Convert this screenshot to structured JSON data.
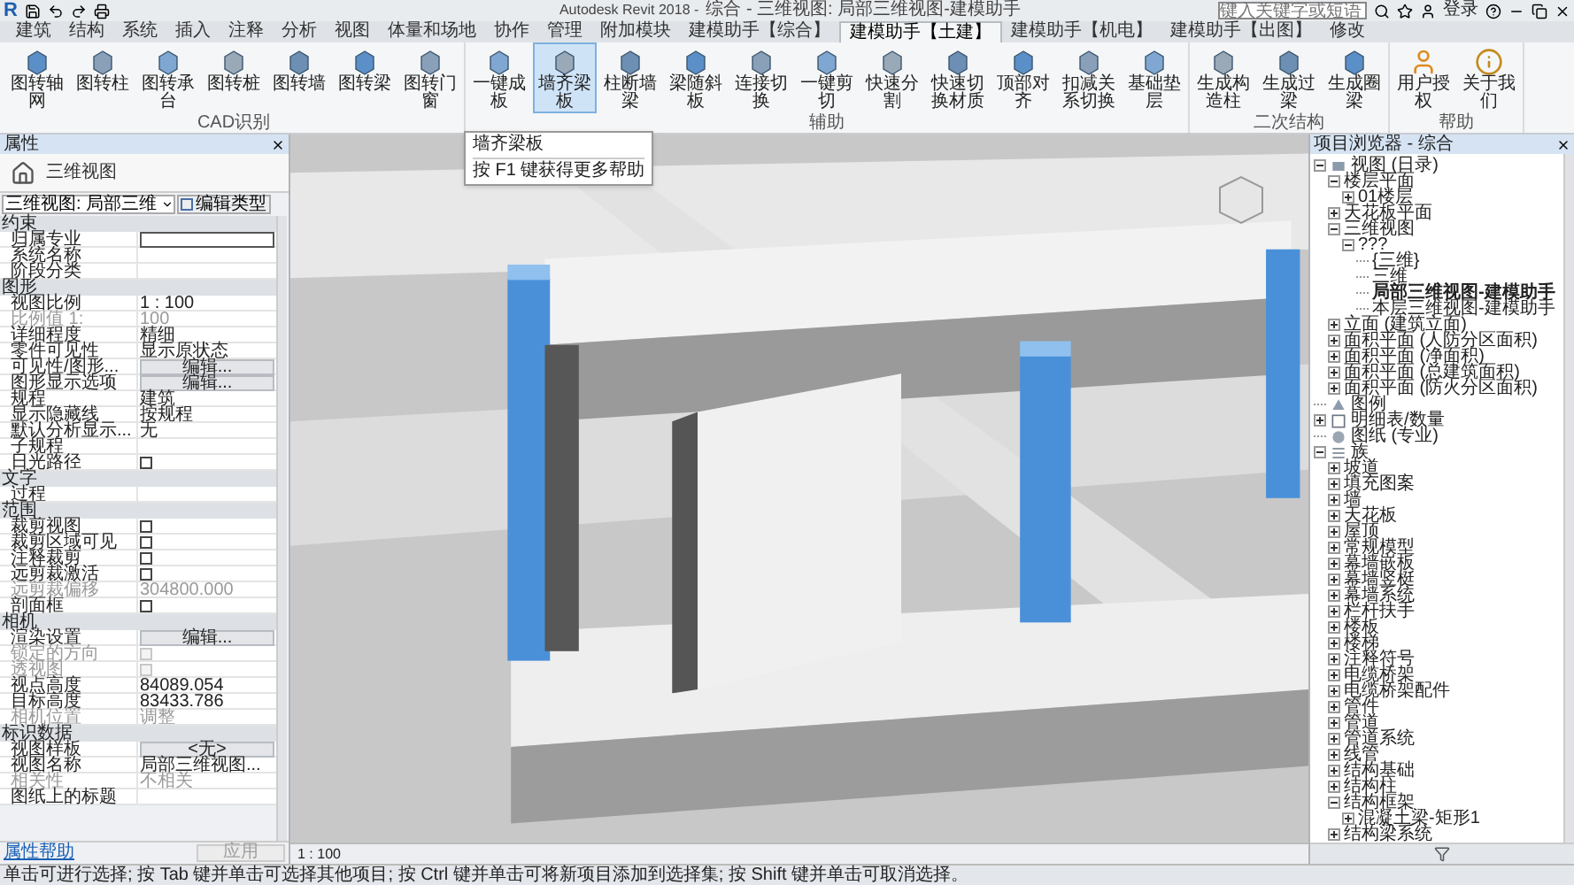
{
  "title_bar": {
    "app": "R",
    "title": "Autodesk Revit 2018 -",
    "document": "综合 - 三维视图: 局部三维视图-建模助手",
    "search": {
      "placeholder": "键入关键字或短语"
    },
    "sign_in": "登录"
  },
  "tabs": [
    {
      "label": "建筑",
      "selected": false
    },
    {
      "label": "结构",
      "selected": false
    },
    {
      "label": "系统",
      "selected": false
    },
    {
      "label": "插入",
      "selected": false
    },
    {
      "label": "注释",
      "selected": false
    },
    {
      "label": "分析",
      "selected": false
    },
    {
      "label": "视图",
      "selected": false
    },
    {
      "label": "体量和场地",
      "selected": false
    },
    {
      "label": "协作",
      "selected": false
    },
    {
      "label": "管理",
      "selected": false
    },
    {
      "label": "附加模块",
      "selected": false
    },
    {
      "label": "建模助手【综合】",
      "selected": false
    },
    {
      "label": "建模助手【土建】",
      "selected": true
    },
    {
      "label": "建模助手【机电】",
      "selected": false
    },
    {
      "label": "建模助手【出图】",
      "selected": false
    },
    {
      "label": "修改",
      "selected": false
    }
  ],
  "ribbon": {
    "groups": [
      {
        "label": "CAD识别",
        "buttons": [
          {
            "label": "图转轴网",
            "selected": false
          },
          {
            "label": "图转柱",
            "selected": false
          },
          {
            "label": "图转承台",
            "selected": false
          },
          {
            "label": "图转桩",
            "selected": false
          },
          {
            "label": "图转墙",
            "selected": false
          },
          {
            "label": "图转梁",
            "selected": false
          },
          {
            "label": "图转门窗",
            "selected": false
          }
        ]
      },
      {
        "label": "辅助",
        "buttons": [
          {
            "label": "一键成板",
            "selected": false
          },
          {
            "label": "墙齐梁板",
            "selected": true
          },
          {
            "label": "柱断墙梁",
            "selected": false
          },
          {
            "label": "梁随斜板",
            "selected": false
          },
          {
            "label": "连接切换",
            "selected": false
          },
          {
            "label": "一键剪切",
            "selected": false
          },
          {
            "label": "快速分割",
            "selected": false
          },
          {
            "label": "快速切换材质",
            "selected": false
          },
          {
            "label": "顶部对齐",
            "selected": false
          },
          {
            "label": "扣减关系切换",
            "selected": false
          },
          {
            "label": "基础垫层",
            "selected": false
          }
        ]
      },
      {
        "label": "二次结构",
        "buttons": [
          {
            "label": "生成构造柱",
            "selected": false
          },
          {
            "label": "生成过梁",
            "selected": false
          },
          {
            "label": "生成圈梁",
            "selected": false
          }
        ]
      },
      {
        "label": "帮助",
        "buttons": [
          {
            "label": "用户授权",
            "selected": false
          },
          {
            "label": "关于我们",
            "selected": false
          }
        ]
      }
    ]
  },
  "tooltip": {
    "title": "墙齐梁板",
    "hint": "按 F1 键获得更多帮助"
  },
  "properties": {
    "title": "属性",
    "type_name": "三维视图",
    "view_selector": "三维视图: 局部三维",
    "edit_type": "编辑类型",
    "groups": [
      {
        "label": "约束",
        "rows": [
          {
            "label": "归属专业",
            "kind": "input",
            "disabled": false
          },
          {
            "label": "系统名称",
            "kind": "text",
            "disabled": false
          },
          {
            "label": "阶段分类",
            "kind": "text",
            "disabled": false
          }
        ]
      },
      {
        "label": "图形",
        "rows": [
          {
            "label": "视图比例",
            "kind": "text",
            "value": "1 : 100",
            "disabled": false
          },
          {
            "label": "比例值 1:",
            "kind": "text",
            "value": "100",
            "disabled": true
          },
          {
            "label": "详细程度",
            "kind": "text",
            "value": "精细",
            "disabled": false
          },
          {
            "label": "零件可见性",
            "kind": "text",
            "value": "显示原状态",
            "disabled": false
          },
          {
            "label": "可见性/图形...",
            "kind": "button",
            "value": "编辑...",
            "disabled": false
          },
          {
            "label": "图形显示选项",
            "kind": "button",
            "value": "编辑...",
            "disabled": false
          },
          {
            "label": "规程",
            "kind": "text",
            "value": "建筑",
            "disabled": false
          },
          {
            "label": "显示隐藏线",
            "kind": "text",
            "value": "按规程",
            "disabled": false
          },
          {
            "label": "默认分析显示...",
            "kind": "text",
            "value": "无",
            "disabled": false
          },
          {
            "label": "子规程",
            "kind": "text",
            "disabled": false
          },
          {
            "label": "日光路径",
            "kind": "checkbox",
            "checked": false,
            "disabled": false
          }
        ]
      },
      {
        "label": "文字",
        "rows": [
          {
            "label": "过程",
            "kind": "text",
            "disabled": false
          }
        ]
      },
      {
        "label": "范围",
        "rows": [
          {
            "label": "裁剪视图",
            "kind": "checkbox",
            "checked": false,
            "disabled": false
          },
          {
            "label": "裁剪区域可见",
            "kind": "checkbox",
            "checked": false,
            "disabled": false
          },
          {
            "label": "注释裁剪",
            "kind": "checkbox",
            "checked": false,
            "disabled": false
          },
          {
            "label": "远剪裁激活",
            "kind": "checkbox",
            "checked": false,
            "disabled": false
          },
          {
            "label": "远剪裁偏移",
            "kind": "text",
            "value": "304800.000",
            "disabled": true
          },
          {
            "label": "剖面框",
            "kind": "checkbox",
            "checked": false,
            "disabled": false
          }
        ]
      },
      {
        "label": "相机",
        "rows": [
          {
            "label": "渲染设置",
            "kind": "button",
            "value": "编辑...",
            "disabled": false
          },
          {
            "label": "锁定的方向",
            "kind": "checkbox",
            "checked": false,
            "disabled": true
          },
          {
            "label": "透视图",
            "kind": "checkbox",
            "checked": false,
            "disabled": true
          },
          {
            "label": "视点高度",
            "kind": "text",
            "value": "84089.054",
            "disabled": false
          },
          {
            "label": "目标高度",
            "kind": "text",
            "value": "83433.786",
            "disabled": false
          },
          {
            "label": "相机位置",
            "kind": "text",
            "value": "调整",
            "disabled": true
          }
        ]
      },
      {
        "label": "标识数据",
        "rows": [
          {
            "label": "视图样板",
            "kind": "button",
            "value": "<无>",
            "disabled": false
          },
          {
            "label": "视图名称",
            "kind": "text",
            "value": "局部三维视图...",
            "disabled": false
          },
          {
            "label": "相关性",
            "kind": "text",
            "value": "不相关",
            "disabled": true
          },
          {
            "label": "图纸上的标题",
            "kind": "text",
            "disabled": false
          }
        ]
      }
    ],
    "help_link": "属性帮助",
    "apply": {
      "label": "应用",
      "disabled": true
    }
  },
  "viewport": {
    "scale": "1 : 100"
  },
  "project_browser": {
    "title": "项目浏览器 - 综合",
    "tree": [
      {
        "label": "视图 (日录)",
        "kind": "group",
        "expanded": true,
        "children": [
          {
            "label": "楼层平面",
            "kind": "group",
            "expanded": true,
            "children": [
              {
                "label": "01楼层",
                "kind": "group",
                "expanded": false
              }
            ]
          },
          {
            "label": "天花板平面",
            "kind": "group",
            "expanded": false
          },
          {
            "label": "三维视图",
            "kind": "group",
            "expanded": true,
            "children": [
              {
                "label": "???",
                "kind": "group",
                "expanded": true,
                "children": [
                  {
                    "label": "{三维}",
                    "kind": "leaf",
                    "current": false
                  },
                  {
                    "label": "三维",
                    "kind": "leaf",
                    "current": false
                  },
                  {
                    "label": "局部三维视图-建模助手",
                    "kind": "leaf",
                    "current": true
                  },
                  {
                    "label": "本层三维视图-建模助手",
                    "kind": "leaf",
                    "current": false
                  }
                ]
              }
            ]
          },
          {
            "label": "立面 (建筑立面)",
            "kind": "group",
            "expanded": false
          },
          {
            "label": "面积平面 (人防分区面积)",
            "kind": "group",
            "expanded": false
          },
          {
            "label": "面积平面 (净面积)",
            "kind": "group",
            "expanded": false
          },
          {
            "label": "面积平面 (总建筑面积)",
            "kind": "group",
            "expanded": false
          },
          {
            "label": "面积平面 (防火分区面积)",
            "kind": "group",
            "expanded": false
          }
        ]
      },
      {
        "label": "图例",
        "kind": "leaf",
        "current": false
      },
      {
        "label": "明细表/数量",
        "kind": "group",
        "expanded": false
      },
      {
        "label": "图纸 (专业)",
        "kind": "leaf",
        "current": false
      },
      {
        "label": "族",
        "kind": "group",
        "expanded": true,
        "children": [
          {
            "label": "坡道",
            "kind": "group",
            "expanded": false
          },
          {
            "label": "填充图案",
            "kind": "group",
            "expanded": false
          },
          {
            "label": "墙",
            "kind": "group",
            "expanded": false
          },
          {
            "label": "天花板",
            "kind": "group",
            "expanded": false
          },
          {
            "label": "屋顶",
            "kind": "group",
            "expanded": false
          },
          {
            "label": "常规模型",
            "kind": "group",
            "expanded": false
          },
          {
            "label": "幕墙嵌板",
            "kind": "group",
            "expanded": false
          },
          {
            "label": "幕墙竖梃",
            "kind": "group",
            "expanded": false
          },
          {
            "label": "幕墙系统",
            "kind": "group",
            "expanded": false
          },
          {
            "label": "栏杆扶手",
            "kind": "group",
            "expanded": false
          },
          {
            "label": "楼板",
            "kind": "group",
            "expanded": false
          },
          {
            "label": "楼梯",
            "kind": "group",
            "expanded": false
          },
          {
            "label": "注释符号",
            "kind": "group",
            "expanded": false
          },
          {
            "label": "电缆桥架",
            "kind": "group",
            "expanded": false
          },
          {
            "label": "电缆桥架配件",
            "kind": "group",
            "expanded": false
          },
          {
            "label": "管件",
            "kind": "group",
            "expanded": false
          },
          {
            "label": "管道",
            "kind": "group",
            "expanded": false
          },
          {
            "label": "管道系统",
            "kind": "group",
            "expanded": false
          },
          {
            "label": "线管",
            "kind": "group",
            "expanded": false
          },
          {
            "label": "结构基础",
            "kind": "group",
            "expanded": false
          },
          {
            "label": "结构柱",
            "kind": "group",
            "expanded": false
          },
          {
            "label": "结构框架",
            "kind": "group",
            "expanded": true,
            "children": [
              {
                "label": "混凝土梁-矩形1",
                "kind": "group",
                "expanded": false
              }
            ]
          },
          {
            "label": "结构梁系统",
            "kind": "group",
            "expanded": false
          }
        ]
      }
    ]
  },
  "status_bar": {
    "message": "单击可进行选择; 按 Tab 键并单击可选择其他项目; 按 Ctrl 键并单击可将新项目添加到选择集; 按 Shift 键并单击可取消选择。"
  }
}
